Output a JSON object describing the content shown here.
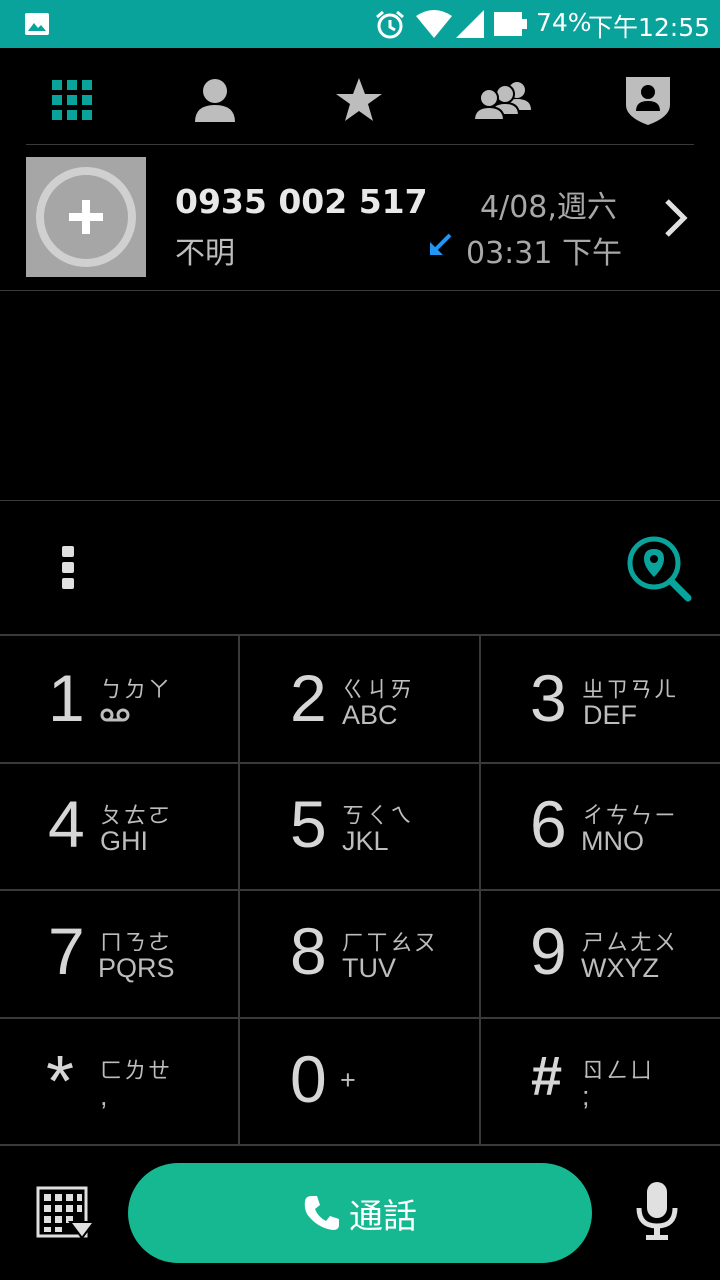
{
  "status_bar": {
    "battery_percent": "74%",
    "time": "下午12:55",
    "icons": [
      "image-icon",
      "alarm-icon",
      "wifi-icon",
      "signal-icon",
      "battery-icon"
    ]
  },
  "tabs": [
    {
      "name": "dialpad-tab",
      "icon": "dialpad-grid-icon",
      "active": true
    },
    {
      "name": "contacts-tab",
      "icon": "person-icon"
    },
    {
      "name": "favorites-tab",
      "icon": "star-icon"
    },
    {
      "name": "groups-tab",
      "icon": "group-icon"
    },
    {
      "name": "private-tab",
      "icon": "shield-person-icon"
    }
  ],
  "recent_call": {
    "number": "0935 002 517",
    "label": "不明",
    "date": "4/08,週六",
    "time": "03:31 下午",
    "direction_icon": "incoming-call-arrow-icon"
  },
  "keypad": [
    {
      "digit": "1",
      "zhuyin": "ㄅㄉㄚ",
      "letters": "ᴓᴓ"
    },
    {
      "digit": "2",
      "zhuyin": "ㄍㄐㄞ",
      "letters": "ABC"
    },
    {
      "digit": "3",
      "zhuyin": "ㄓㄗㄢㄦ",
      "letters": "DEF"
    },
    {
      "digit": "4",
      "zhuyin": "ㄆㄊㄛ",
      "letters": "GHI"
    },
    {
      "digit": "5",
      "zhuyin": "ㄎㄑㄟ",
      "letters": "JKL"
    },
    {
      "digit": "6",
      "zhuyin": "ㄔㄘㄣㄧ",
      "letters": "MNO"
    },
    {
      "digit": "7",
      "zhuyin": "ㄇㄋㄜ",
      "letters": "PQRS"
    },
    {
      "digit": "8",
      "zhuyin": "ㄏㄒㄠㄡ",
      "letters": "TUV"
    },
    {
      "digit": "9",
      "zhuyin": "ㄕㄙㄤㄨ",
      "letters": "WXYZ"
    },
    {
      "digit": "*",
      "zhuyin": "ㄈㄌㄝ",
      "letters": ","
    },
    {
      "digit": "0",
      "zhuyin": "",
      "letters": "+"
    },
    {
      "digit": "#",
      "zhuyin": "ㄖㄥㄩ",
      "letters": ";"
    }
  ],
  "call_button": {
    "label": "通話"
  },
  "colors": {
    "accent": "#0aa39c",
    "call_green": "#16b892",
    "incoming_arrow": "#2196f3"
  }
}
